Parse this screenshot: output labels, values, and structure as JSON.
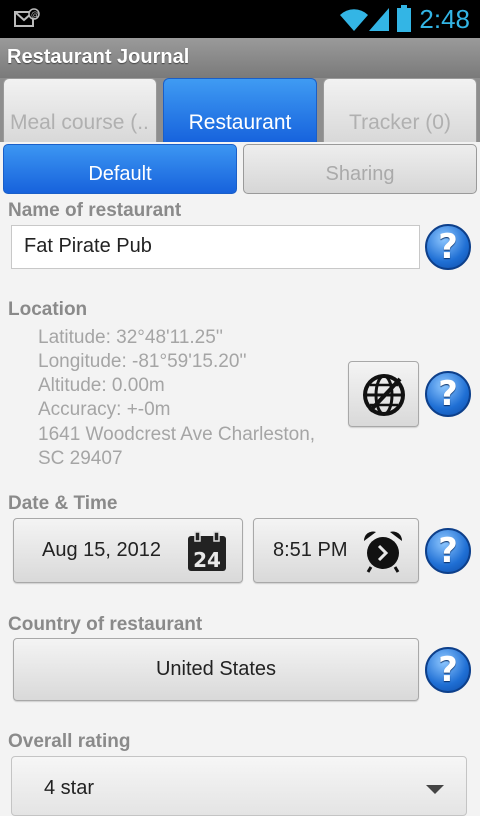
{
  "statusbar": {
    "time": "2:48"
  },
  "titlebar": {
    "title": "Restaurant Journal"
  },
  "tabs": [
    {
      "label": "Meal course (..",
      "active": false
    },
    {
      "label": "Restaurant",
      "active": true
    },
    {
      "label": "Tracker (0)",
      "active": false
    }
  ],
  "subtabs": [
    {
      "label": "Default",
      "active": true
    },
    {
      "label": "Sharing",
      "active": false
    }
  ],
  "restaurant_name": {
    "label": "Name of restaurant",
    "value": "Fat Pirate Pub"
  },
  "location": {
    "label": "Location",
    "latitude": "Latitude: 32°48'11.25''",
    "longitude": "Longitude: -81°59'15.20''",
    "altitude": "Altitude: 0.00m",
    "accuracy": "Accuracy: +-0m",
    "address_line1": "1641 Woodcrest Ave Charleston,",
    "address_line2": "SC 29407"
  },
  "datetime": {
    "label": "Date & Time",
    "date": "Aug 15, 2012",
    "calendar_day": "24",
    "time": "8:51 PM"
  },
  "country": {
    "label": "Country of restaurant",
    "value": "United States"
  },
  "rating": {
    "label": "Overall rating",
    "value": "4 star"
  },
  "help_glyph": "?",
  "colors": {
    "accent_blue": "#1f6fd4",
    "statusbar_text": "#33b5e5"
  }
}
